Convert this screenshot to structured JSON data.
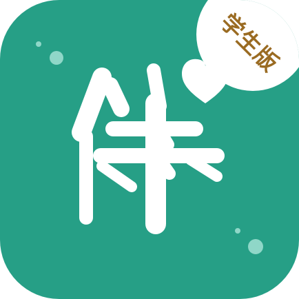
{
  "icon": {
    "glyph": "伴",
    "badge_label": "学生版",
    "heart": "heart-icon"
  },
  "colors": {
    "background": "#269f86",
    "glyph": "#ffffff",
    "badge_background": "#ffffff",
    "badge_text": "#9a6b22",
    "dots": "#8fd7c8"
  }
}
